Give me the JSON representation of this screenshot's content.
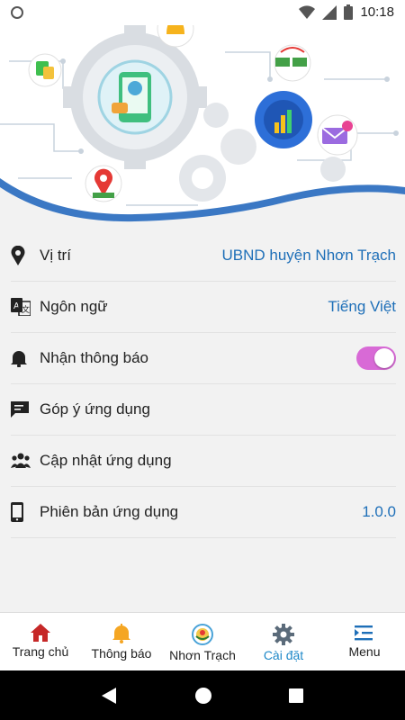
{
  "status_bar": {
    "time": "10:18"
  },
  "settings": {
    "items": [
      {
        "label": "Vị trí",
        "value": "UBND huyện Nhơn Trạch",
        "icon": "location-pin-icon"
      },
      {
        "label": "Ngôn ngữ",
        "value": "Tiếng Việt",
        "icon": "translate-icon"
      },
      {
        "label": "Nhận thông báo",
        "icon": "bell-icon",
        "toggle_on": true
      },
      {
        "label": "Góp ý ứng dụng",
        "icon": "feedback-icon"
      },
      {
        "label": "Cập nhật ứng dụng",
        "icon": "people-icon"
      },
      {
        "label": "Phiên bản ứng dụng",
        "value": "1.0.0",
        "icon": "phone-icon"
      }
    ]
  },
  "tabbar": {
    "tabs": [
      {
        "label": "Trang chủ",
        "icon": "home-icon"
      },
      {
        "label": "Thông báo",
        "icon": "bell-icon"
      },
      {
        "label": "Nhơn Trạch",
        "icon": "emblem-icon"
      },
      {
        "label": "Cài đặt",
        "icon": "gear-icon",
        "active": true
      },
      {
        "label": "Menu",
        "icon": "menu-icon"
      }
    ]
  },
  "colors": {
    "accent": "#1e88c8",
    "value_text": "#1e6fb8",
    "toggle": "#d86ad6",
    "home": "#c62828"
  }
}
